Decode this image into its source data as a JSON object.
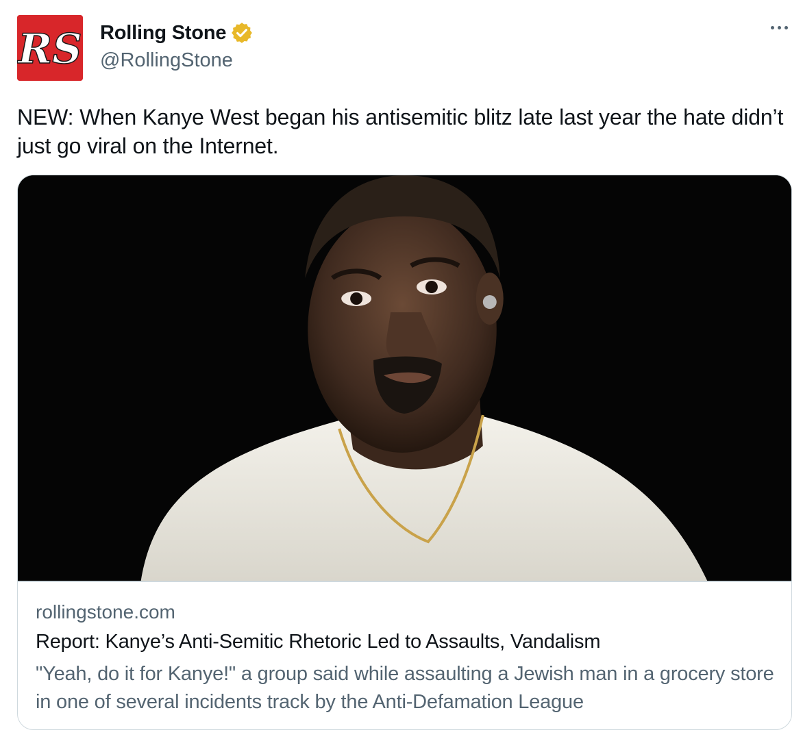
{
  "author": {
    "display_name": "Rolling Stone",
    "handle": "@RollingStone",
    "avatar_text": "RS",
    "avatar_color": "#d8262a",
    "verified_badge_color": "#e8b829"
  },
  "menu": {
    "icon": "more-horizontal-icon"
  },
  "tweet": {
    "text": "NEW: When Kanye West began his antisemitic blitz late last year the hate didn’t just go viral on the Internet."
  },
  "link_card": {
    "domain": "rollingstone.com",
    "title": "Report: Kanye’s Anti-Semitic Rhetoric Led to Assaults, Vandalism",
    "description": "\"Yeah, do it for Kanye!\" a group said while assaulting a Jewish man in a grocery store in one of several incidents track by the Anti-Defamation League"
  },
  "colors": {
    "text_primary": "#0f1419",
    "text_secondary": "#536471",
    "border": "#cfd9de"
  }
}
